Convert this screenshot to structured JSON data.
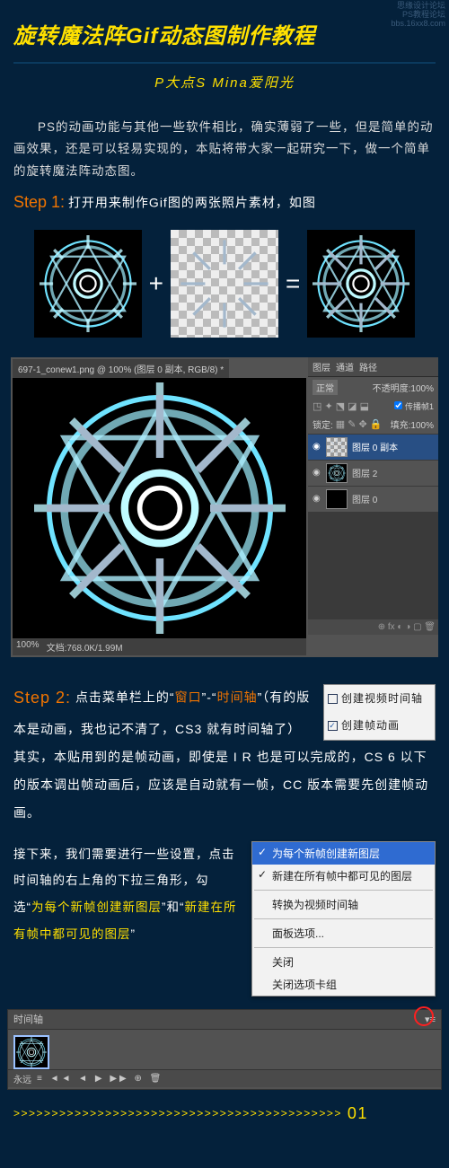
{
  "watermark": {
    "line1": "思缘设计论坛",
    "line2": "PS教程论坛",
    "line3": "bbs.16xx8.com"
  },
  "header": {
    "title": "旋转魔法阵Gif动态图制作教程",
    "subtitle": "P大点S Mina爱阳光"
  },
  "intro": "PS的动画功能与其他一些软件相比，确实薄弱了一些，但是简单的动画效果，还是可以轻易实现的，本贴将带大家一起研究一下，做一个简单的旋转魔法阵动态图。",
  "step1": {
    "label": "Step 1:",
    "text": "打开用来制作Gif图的两张照片素材，如图"
  },
  "ops": {
    "plus": "+",
    "equals": "="
  },
  "ps": {
    "tab": "697-1_conew1.png @ 100% (图层 0 副本, RGB/8) *",
    "zoom": "100%",
    "status": "文档:768.0K/1.99M",
    "panel": {
      "tab1": "图层",
      "tab2": "通道",
      "tab3": "路径"
    },
    "row1a": "正常",
    "row1b_label": "不透明度:",
    "row1b_val": "100%",
    "row2a": "锁定:",
    "row2b_label": "填充:",
    "row2b_val": "100%",
    "passthrough": "传播帧1",
    "layers": [
      {
        "name": "图层 0 副本",
        "sel": true
      },
      {
        "name": "图层 2",
        "sel": false
      },
      {
        "name": "图层 0",
        "sel": false
      }
    ]
  },
  "step2": {
    "label": "Step 2:",
    "parts": {
      "p1": "点击菜单栏上的“",
      "w1": "窗口",
      "p2": "”-“",
      "w2": "时间轴",
      "p3": "”（有的版本是动画，我也记不清了，CS3 就有时间轴了）其实，本贴用到的是帧动画，即使是 I R 也是可以完成的，CS 6 以下的版本调出帧动画后，应该是自动就有一帧，CC 版本需要先创建帧动画。"
    },
    "dlg": {
      "opt1": "创建视频时间轴",
      "opt2": "创建帧动画"
    }
  },
  "lower": {
    "p1": "接下来，我们需要进行一些设置，点击时间轴的右上角的下拉三角形，勾选“",
    "w1": "为每个新帧创建新图层",
    "p2": "”和“",
    "w2": "新建在所有帧中都可见的图层",
    "p3": "”"
  },
  "ctx": {
    "i1": "为每个新帧创建新图层",
    "i2": "新建在所有帧中都可见的图层",
    "i3": "转换为视频时间轴",
    "i4": "面板选项...",
    "i5": "关闭",
    "i6": "关闭选项卡组"
  },
  "timeline": {
    "tab": "时间轴",
    "forever": "永远",
    "controls": "≡  ◄◄ ◄ ▶ ▶▶   ⊕ 🗑"
  },
  "footer": {
    "arrows": ">>>>>>>>>>>>>>>>>>>>>>>>>>>>>>>>>>>>>>>>>>>",
    "page": "01"
  }
}
